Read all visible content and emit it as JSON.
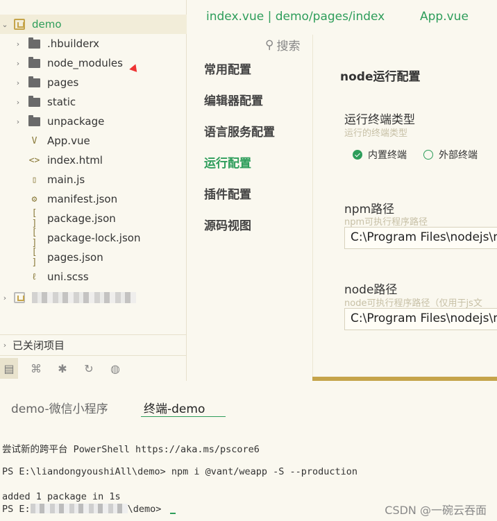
{
  "project": {
    "name": "demo"
  },
  "tree": [
    {
      "label": ".hbuilderx",
      "type": "folder"
    },
    {
      "label": "node_modules",
      "type": "folder"
    },
    {
      "label": "pages",
      "type": "folder"
    },
    {
      "label": "static",
      "type": "folder"
    },
    {
      "label": "unpackage",
      "type": "folder"
    },
    {
      "label": "App.vue",
      "type": "vue"
    },
    {
      "label": "index.html",
      "type": "html"
    },
    {
      "label": "main.js",
      "type": "js"
    },
    {
      "label": "manifest.json",
      "type": "manifest"
    },
    {
      "label": "package.json",
      "type": "json"
    },
    {
      "label": "package-lock.json",
      "type": "json"
    },
    {
      "label": "pages.json",
      "type": "json"
    },
    {
      "label": "uni.scss",
      "type": "scss"
    }
  ],
  "closed_projects_label": "已关闭项目",
  "tabs": [
    {
      "label": "index.vue | demo/pages/index"
    },
    {
      "label": "App.vue"
    }
  ],
  "settings": {
    "search_label": "搜索",
    "nav": [
      {
        "label": "常用配置",
        "active": false
      },
      {
        "label": "编辑器配置",
        "active": false
      },
      {
        "label": "语言服务配置",
        "active": false
      },
      {
        "label": "运行配置",
        "active": true
      },
      {
        "label": "插件配置",
        "active": false
      },
      {
        "label": "源码视图",
        "active": false
      }
    ],
    "panel_title": "node运行配置",
    "terminal_type": {
      "label": "运行终端类型",
      "hint": "运行的终端类型",
      "options": [
        "内置终端",
        "外部终端"
      ],
      "selected": "内置终端"
    },
    "npm_path": {
      "label": "npm路径",
      "hint": "npm可执行程序路径",
      "value": "C:\\Program Files\\nodejs\\n"
    },
    "node_path": {
      "label": "node路径",
      "hint": "node可执行程序路径（仅用于js文",
      "value": "C:\\Program Files\\nodejs\\n"
    }
  },
  "terminal": {
    "tabs": [
      {
        "label": "demo-微信小程序",
        "active": false
      },
      {
        "label": "终端-demo",
        "active": true
      }
    ],
    "lines": {
      "line1": "尝试新的跨平台 PowerShell https://aka.ms/pscore6",
      "prompt": "PS E:\\liandongyoushiAll\\demo> ",
      "command": "npm i @vant/weapp -S --production",
      "line3": "added 1 package in 1s",
      "prompt2_start": "PS E:",
      "prompt2_end": "\\demo> "
    }
  },
  "watermark": "CSDN @一碗云吞面",
  "colors": {
    "accent": "#2d9d5a",
    "gold": "#c5a44a",
    "background": "#faf8ef"
  }
}
